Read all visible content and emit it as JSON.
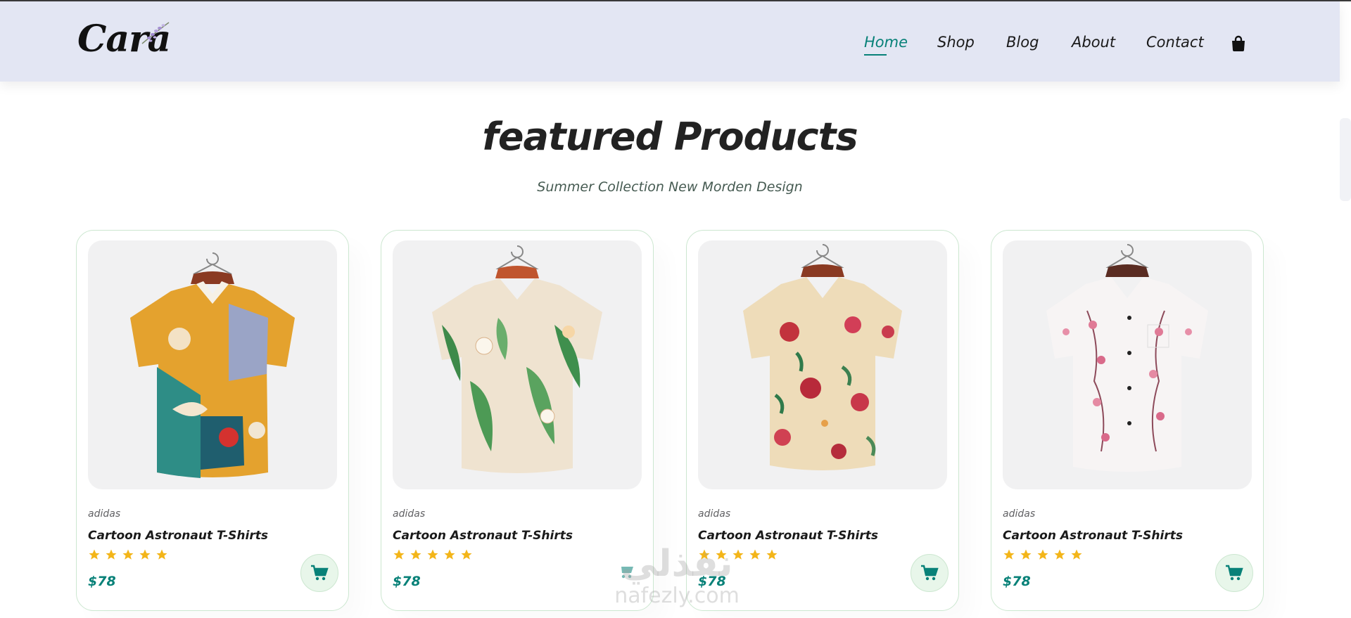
{
  "brand": {
    "logo_text": "Cara",
    "logo_icon": "lavender-sprig-icon"
  },
  "nav": {
    "items": [
      {
        "label": "Home",
        "active": true
      },
      {
        "label": "Shop",
        "active": false
      },
      {
        "label": "Blog",
        "active": false
      },
      {
        "label": "About",
        "active": false
      },
      {
        "label": "Contact",
        "active": false
      }
    ],
    "cart_icon": "shopping-bag-icon"
  },
  "section": {
    "title": "featured Products",
    "subtitle": "Summer Collection New Morden Design"
  },
  "products": [
    {
      "brand": "adidas",
      "name": "Cartoon Astronaut T-Shirts",
      "rating": 5,
      "price": "$78",
      "image_icon": "colorful-abstract-shirt-icon"
    },
    {
      "brand": "adidas",
      "name": "Cartoon Astronaut T-Shirts",
      "rating": 5,
      "price": "$78",
      "image_icon": "tropical-leaf-shirt-icon"
    },
    {
      "brand": "adidas",
      "name": "Cartoon Astronaut T-Shirts",
      "rating": 5,
      "price": "$78",
      "image_icon": "floral-rose-shirt-icon"
    },
    {
      "brand": "adidas",
      "name": "Cartoon Astronaut T-Shirts",
      "rating": 5,
      "price": "$78",
      "image_icon": "pink-blossom-shirt-icon"
    }
  ],
  "watermark": {
    "arabic": "نفذلي",
    "latin": "nafezly.com"
  },
  "colors": {
    "accent": "#088178",
    "header_bg": "#e3e6f3",
    "star": "#f3b519",
    "card_border": "#cce7d0",
    "cart_bg": "#e8f6ea"
  }
}
